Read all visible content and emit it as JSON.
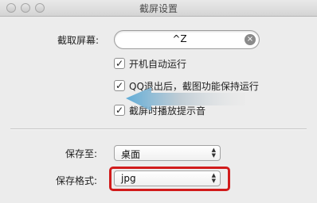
{
  "window": {
    "title": "截屏设置"
  },
  "shortcut": {
    "label": "截取屏幕:",
    "value": "^Z"
  },
  "checkboxes": [
    {
      "label": "开机自动运行",
      "checked": true
    },
    {
      "label": "QQ退出后，截图功能保持运行",
      "checked": true
    },
    {
      "label": "截屏时播放提示音",
      "checked": true
    }
  ],
  "save_location": {
    "label": "保存至:",
    "value": "桌面"
  },
  "save_format": {
    "label": "保存格式:",
    "value": "jpg"
  },
  "icons": {
    "check": "✓",
    "clear": "×",
    "popup_arrows": "▲▼"
  },
  "colors": {
    "highlight": "#d11b1b",
    "arrow": "#5aa9d6"
  }
}
